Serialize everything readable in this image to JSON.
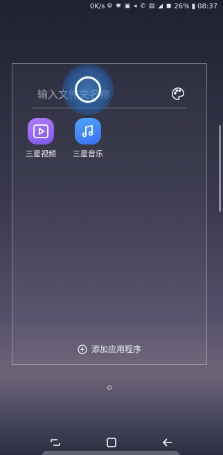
{
  "status_bar": {
    "speed": "0K/s",
    "battery": "26%",
    "time": "08:37"
  },
  "folder": {
    "name_placeholder": "输入文件夹名称",
    "apps": [
      {
        "label": "三星视频",
        "icon": "play-icon",
        "color": "#9a6bf7"
      },
      {
        "label": "三星音乐",
        "icon": "music-note-icon",
        "color": "#4a8cf7"
      }
    ],
    "add_apps_label": "添加应用程序"
  },
  "navigation": {
    "buttons": [
      "recent-apps",
      "home",
      "back"
    ]
  }
}
